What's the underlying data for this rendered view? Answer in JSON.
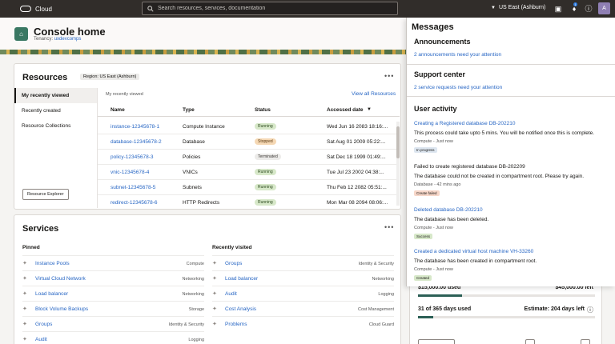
{
  "topbar": {
    "brand": "Cloud",
    "search_placeholder": "Search resources, services, documentation",
    "region": "US East (Ashburn)",
    "notification_count": "1",
    "avatar_initial": "A"
  },
  "header": {
    "title": "Console home",
    "tenancy_label": "Tenancy:",
    "tenancy_value": "uxdevcomps"
  },
  "resources": {
    "title": "Resources",
    "region_badge": "Region: US East (Ashburn)",
    "nav": [
      "My recently viewed",
      "Recently created",
      "Resource Collections"
    ],
    "explorer_button": "Resource Explorer",
    "subtitle": "My recently viewed",
    "view_all": "View all Resources",
    "columns": [
      "Name",
      "Type",
      "Status",
      "Accessed date"
    ],
    "rows": [
      {
        "name": "instance-12345678-1",
        "type": "Compute Instance",
        "status": "Running",
        "date": "Wed Jun 16 2083 18:16:..."
      },
      {
        "name": "database-12345678-2",
        "type": "Database",
        "status": "Stopped",
        "date": "Sat Aug 01 2009 05:22:..."
      },
      {
        "name": "policy-12345678-3",
        "type": "Policies",
        "status": "Terminated",
        "date": "Sat Dec 18 1999 01:49:..."
      },
      {
        "name": "vnic-12345678-4",
        "type": "VNICs",
        "status": "Running",
        "date": "Tue Jul 23 2002 04:38:..."
      },
      {
        "name": "subnet-12345678-5",
        "type": "Subnets",
        "status": "Running",
        "date": "Thu Feb 12 2082 05:51:..."
      },
      {
        "name": "redirect-12345678-6",
        "type": "HTTP Redirects",
        "status": "Running",
        "date": "Mon Mar 08 2094 08:06:..."
      }
    ]
  },
  "services": {
    "title": "Services",
    "pinned_label": "Pinned",
    "recent_label": "Recently visited",
    "pinned": [
      {
        "name": "Instance Pools",
        "category": "Compute"
      },
      {
        "name": "Virtual Cloud Network",
        "category": "Networking"
      },
      {
        "name": "Load balancer",
        "category": "Networking"
      },
      {
        "name": "Block Volume Backups",
        "category": "Storage"
      },
      {
        "name": "Groups",
        "category": "Identity & Security"
      },
      {
        "name": "Audit",
        "category": "Logging"
      }
    ],
    "recent": [
      {
        "name": "Groups",
        "category": "Identity & Security"
      },
      {
        "name": "Load balancer",
        "category": "Networking"
      },
      {
        "name": "Audit",
        "category": "Logging"
      },
      {
        "name": "Cost Analysis",
        "category": "Cost Management"
      },
      {
        "name": "Problems",
        "category": "Cloud Guard"
      }
    ]
  },
  "billing": {
    "used": "$15,000.00 used",
    "left": "$45,000.00 left",
    "spend_fraction": 0.25,
    "days_used": "31 of 365 days used",
    "estimate": "Estimate: 204 days left",
    "days_fraction": 0.085
  },
  "messages": {
    "title": "Messages",
    "announcements_title": "Announcements",
    "announcements_link": "2 announcements need your attention",
    "support_title": "Support center",
    "support_link": "2 service requests need your attention",
    "activity_title": "User activity",
    "activities": [
      {
        "title": "Creating a  Registered database DB-202210",
        "link": true,
        "message": "This process could take upto 5 mins. You will be notified once this is complete.",
        "meta": "Compute - Just now",
        "tag": "In progress",
        "tag_style": "prog"
      },
      {
        "title": "Failed to create registered database DB-202209",
        "link": false,
        "message": "The database could not be created in compartment root. Please try again.",
        "meta": "Database - 42 mins ago",
        "tag": "Create failed",
        "tag_style": "fail"
      },
      {
        "title": "Deleted database DB-202210",
        "link": true,
        "message": "The database has been deleted.",
        "meta": "Compute - Just now",
        "tag": "Success",
        "tag_style": "ok"
      },
      {
        "title": "Created a dedicated virtual host machine VH-33260",
        "link": true,
        "message": "The database has been created in compartment root.",
        "meta": "Compute - Just now",
        "tag": "Created",
        "tag_style": "created"
      }
    ]
  },
  "colors": {
    "topbar": "#312d2a",
    "link": "#2766c4",
    "brand_green": "#3a7863",
    "meter_fill": "#2b5f55"
  }
}
